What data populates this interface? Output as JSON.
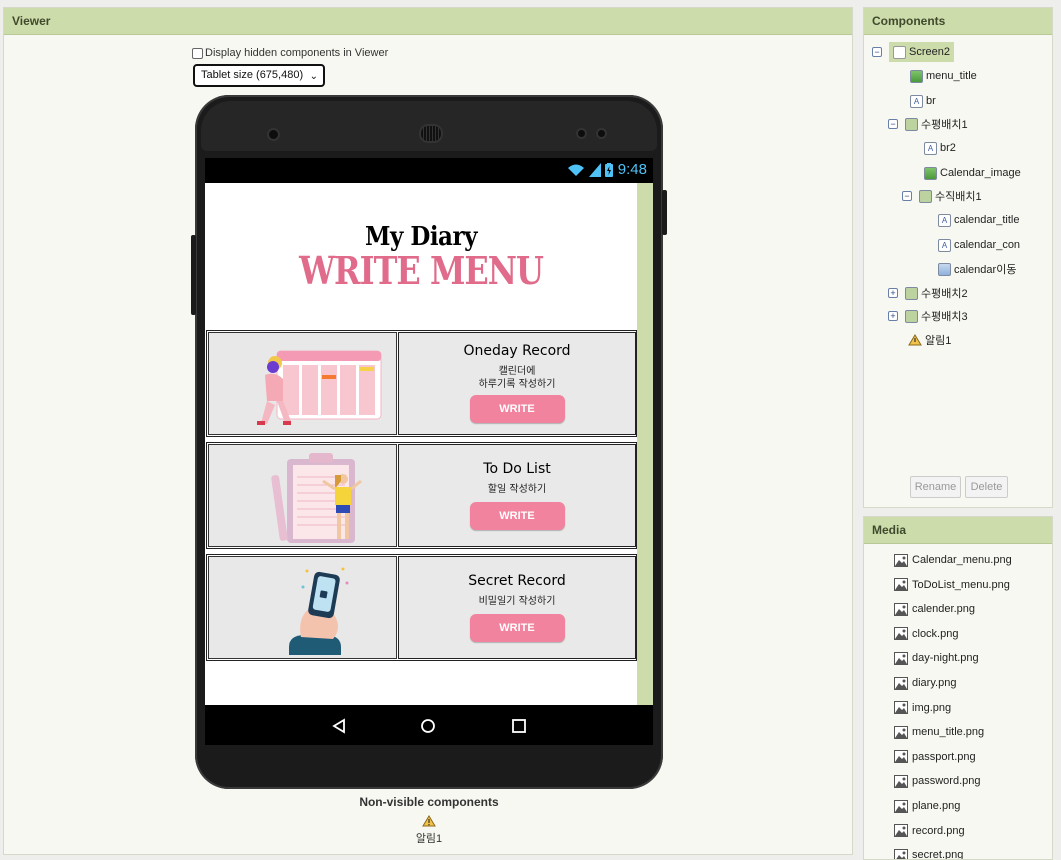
{
  "viewer": {
    "title": "Viewer",
    "display_hidden_label": "Display hidden components in Viewer",
    "size_select": "Tablet size (675,480)",
    "status_time": "9:48",
    "app": {
      "title_line1": "My Diary",
      "title_line2": "WRITE MENU",
      "cards": [
        {
          "title": "Oneday Record",
          "desc1": "캘린더에",
          "desc2": "하루기록 작성하기",
          "button": "WRITE"
        },
        {
          "title": "To Do List",
          "desc1": "할일 작성하기",
          "desc2": "",
          "button": "WRITE"
        },
        {
          "title": "Secret Record",
          "desc1": "비밀일기 작성하기",
          "desc2": "",
          "button": "WRITE"
        }
      ]
    },
    "nonvisible_title": "Non-visible components",
    "nonvisible_items": [
      "알림1"
    ]
  },
  "components": {
    "title": "Components",
    "tree": [
      {
        "label": "Screen2"
      },
      {
        "label": "menu_title"
      },
      {
        "label": "br"
      },
      {
        "label": "수평배치1"
      },
      {
        "label": "br2"
      },
      {
        "label": "Calendar_image"
      },
      {
        "label": "수직배치1"
      },
      {
        "label": "calendar_title"
      },
      {
        "label": "calendar_con"
      },
      {
        "label": "calendar이동"
      },
      {
        "label": "수평배치2"
      },
      {
        "label": "수평배치3"
      },
      {
        "label": "알림1"
      }
    ],
    "rename": "Rename",
    "delete": "Delete"
  },
  "media": {
    "title": "Media",
    "files": [
      "Calendar_menu.png",
      "ToDoList_menu.png",
      "calender.png",
      "clock.png",
      "day-night.png",
      "diary.png",
      "img.png",
      "menu_title.png",
      "passport.png",
      "password.png",
      "plane.png",
      "record.png",
      "secret.png"
    ]
  },
  "colors": {
    "header": "#cddcab",
    "write_button": "#f1839e",
    "title_pink": "#e06b8a"
  }
}
